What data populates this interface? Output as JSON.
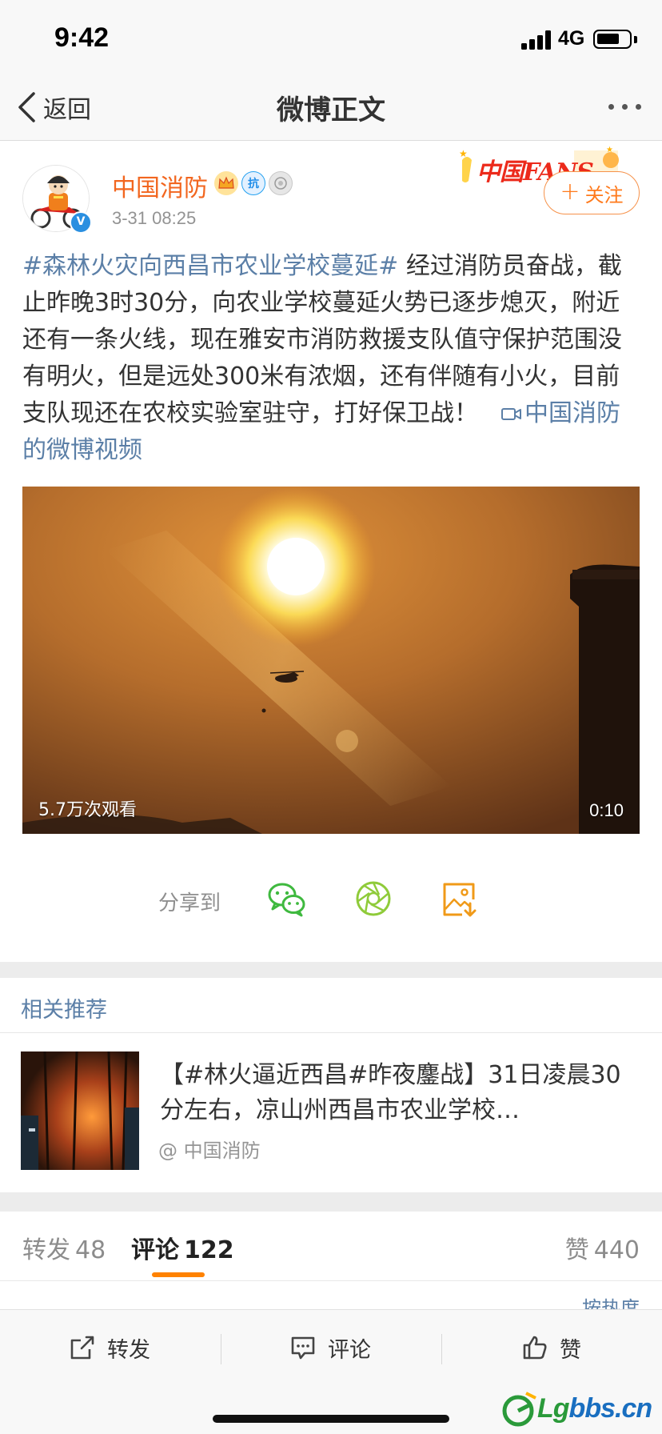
{
  "status_bar": {
    "time": "9:42",
    "network": "4G"
  },
  "nav": {
    "back_label": "返回",
    "title": "微博正文"
  },
  "author": {
    "name": "中国消防",
    "time": "3-31 08:25",
    "verified_mark": "V",
    "badge_shield": "抗",
    "banner_text": "中国FANS",
    "follow_label": "关注"
  },
  "post": {
    "topic": "#森林火灾向西昌市农业学校蔓延#",
    "body": " 经过消防员奋战，截止昨晚3时30分，向农业学校蔓延火势已逐步熄灭，附近还有一条火线，现在雅安市消防救援支队值守保护范围没有明火，但是远处300米有浓烟，还有伴随有小火，目前支队现还在农校实验室驻守，打好保卫战！",
    "video_link": "中国消防的微博视频"
  },
  "video": {
    "views": "5.7万次观看",
    "duration": "0:10"
  },
  "share": {
    "label": "分享到",
    "targets": [
      "wechat-icon",
      "moments-icon",
      "save-image-icon"
    ]
  },
  "related": {
    "title": "相关推荐",
    "item": {
      "text": "【#林火逼近西昌#昨夜鏖战】31日凌晨30分左右，凉山州西昌市农业学校…",
      "source": "@ 中国消防"
    }
  },
  "tabs": {
    "repost": {
      "label": "转发",
      "count": "48"
    },
    "comment": {
      "label": "评论",
      "count": "122"
    },
    "like": {
      "label": "赞",
      "count": "440"
    }
  },
  "sort_peek": "按热度",
  "actions": {
    "repost": "转发",
    "comment": "评论",
    "like": "赞"
  },
  "watermark": {
    "text_green": "Lg",
    "text_blue": "bbs.cn"
  },
  "colors": {
    "brand_orange": "#f2661f",
    "link_blue": "#5b7fa7",
    "tab_indicator": "#ff8200",
    "wechat_green": "#3fb93f",
    "save_orange": "#f09a18"
  }
}
